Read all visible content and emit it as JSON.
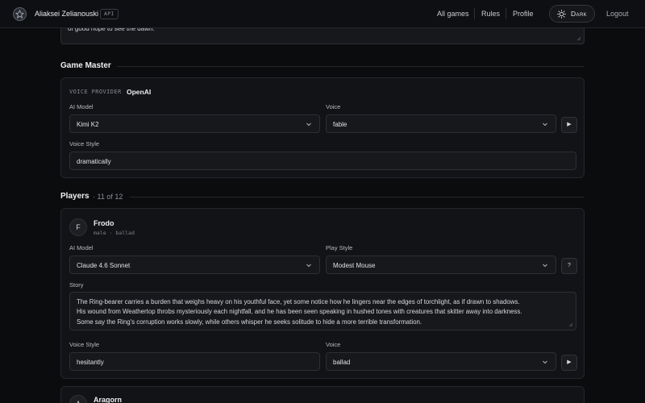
{
  "header": {
    "user_name": "Aliaksei Zelianouski",
    "api_badge": "API",
    "nav": [
      "All games",
      "Rules",
      "Profile"
    ],
    "theme_label": "Dark",
    "logout_label": "Logout"
  },
  "top_fragment": {
    "text": "of good hope to see the dawn."
  },
  "game_master": {
    "title": "Game Master",
    "voice_provider_label": "VOICE PROVIDER",
    "voice_provider_value": "OpenAI",
    "ai_model_label": "AI Model",
    "ai_model_value": "Kimi K2",
    "voice_label": "Voice",
    "voice_value": "fable",
    "play_glyph": "▶",
    "voice_style_label": "Voice Style",
    "voice_style_value": "dramatically"
  },
  "players": {
    "title": "Players",
    "count": "· 11 of 12",
    "list": [
      {
        "initial": "F",
        "name": "Frodo",
        "meta": "male · ballad",
        "ai_model_label": "AI Model",
        "ai_model_value": "Claude 4.6 Sonnet",
        "play_style_label": "Play Style",
        "play_style_value": "Modest Mouse",
        "help_glyph": "?",
        "story_label": "Story",
        "story_lines": [
          "The Ring-bearer carries a burden that weighs heavy on his youthful face, yet some notice how he lingers near the edges of torchlight, as if drawn to shadows.",
          "His wound from Weathertop throbs mysteriously each nightfall, and he has been seen speaking in hushed tones with creatures that skitter away into darkness.",
          "Some say the Ring's corruption works slowly, while others whisper he seeks solitude to hide a more terrible transformation."
        ],
        "voice_style_label": "Voice Style",
        "voice_style_value": "hesitantly",
        "voice_label": "Voice",
        "voice_value": "ballad",
        "play_glyph": "▶"
      },
      {
        "initial": "A",
        "name": "Aragorn"
      }
    ]
  }
}
